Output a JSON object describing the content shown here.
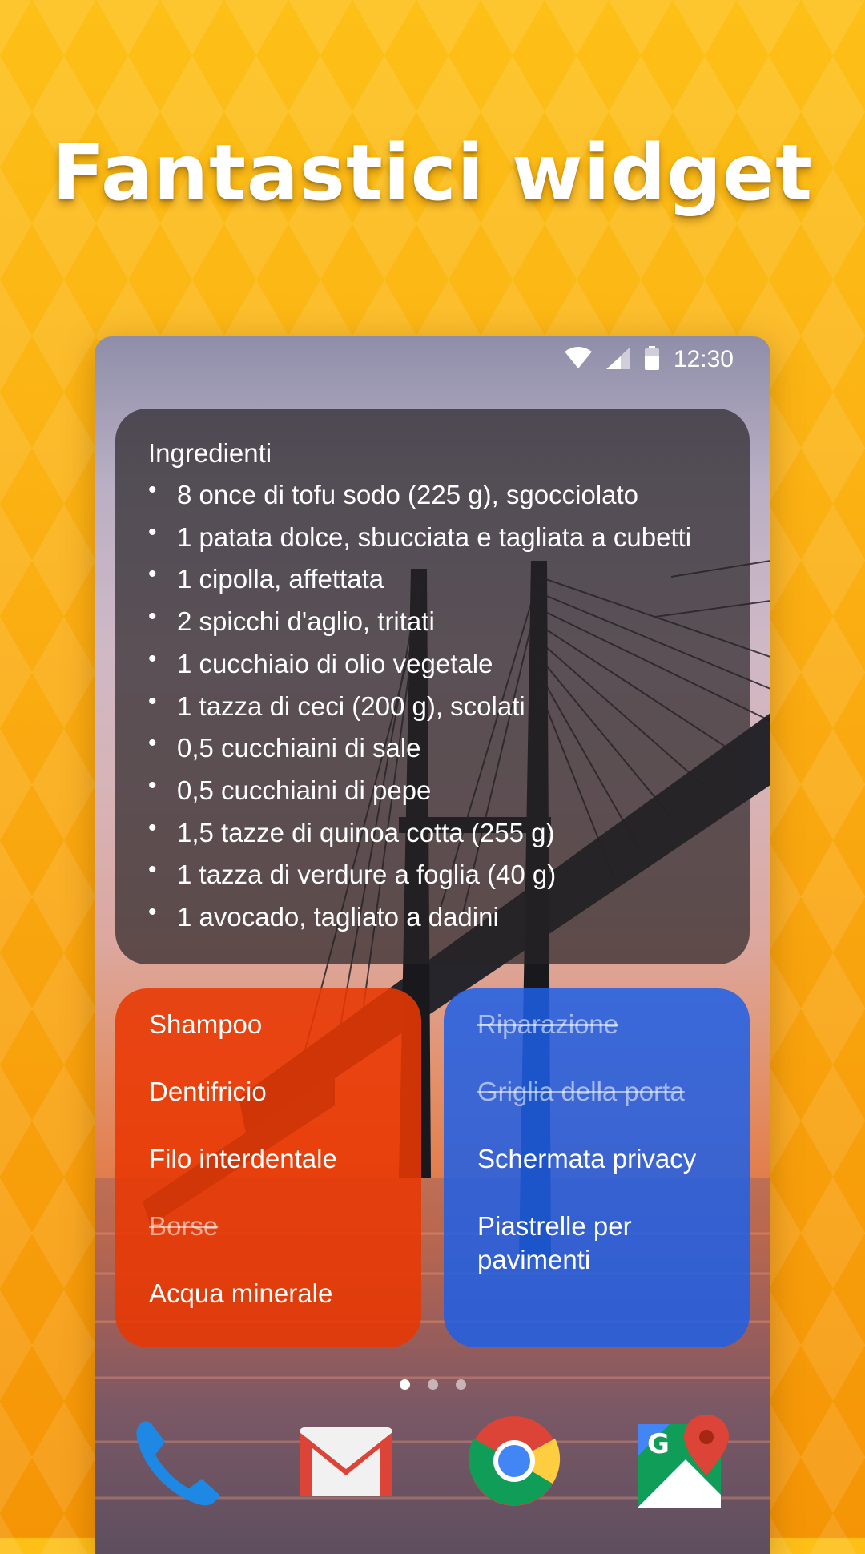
{
  "headline": "Fantastici widget",
  "statusbar": {
    "time": "12:30",
    "icons": [
      "wifi-icon",
      "signal-icon",
      "battery-icon"
    ]
  },
  "recipe": {
    "title": "Ingredienti",
    "items": [
      "8 once di tofu sodo (225 g), sgocciolato",
      "1 patata dolce, sbucciata e tagliata a cubetti",
      "1 cipolla, affettata",
      "2 spicchi d'aglio, tritati",
      "1 cucchiaio di olio vegetale",
      "1 tazza di ceci (200 g), scolati",
      "0,5 cucchiaini di sale",
      "0,5 cucchiaini di pepe",
      "1,5 tazze di quinoa cotta (255 g)",
      "1 tazza di verdure a foglia (40 g)",
      "1 avocado, tagliato a dadini"
    ]
  },
  "shopping_list": {
    "color": "#e83803",
    "items": [
      {
        "text": "Shampoo",
        "done": false
      },
      {
        "text": "Dentifricio",
        "done": false
      },
      {
        "text": "Filo interdentale",
        "done": false
      },
      {
        "text": "Borse",
        "done": true
      },
      {
        "text": "Acqua minerale",
        "done": false
      }
    ]
  },
  "todo_list": {
    "color": "#1d5fe8",
    "items": [
      {
        "text": "Riparazione",
        "done": true
      },
      {
        "text": "Griglia della porta",
        "done": true
      },
      {
        "text": "Schermata privacy",
        "done": false
      },
      {
        "text": "Piastrelle per pavimenti",
        "done": false
      }
    ]
  },
  "pager": {
    "pages": 3,
    "active": 1
  },
  "dock": [
    "phone-icon",
    "gmail-icon",
    "chrome-icon",
    "maps-icon"
  ]
}
